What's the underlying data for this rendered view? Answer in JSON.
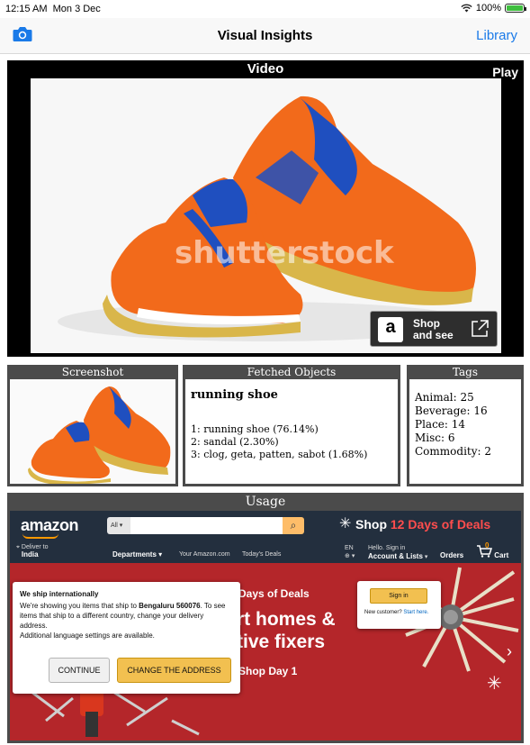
{
  "status_bar": {
    "time": "12:15 AM",
    "date": "Mon 3 Dec",
    "battery": "100%",
    "wifi_icon": "wifi-icon"
  },
  "navbar": {
    "title": "Visual Insights",
    "library_label": "Library",
    "camera_icon": "camera-icon"
  },
  "video": {
    "header": "Video",
    "play_label": "Play",
    "watermark": "shutterstock",
    "shop_button": {
      "line1": "Shop",
      "line2": "and see",
      "logo_letter": "a"
    }
  },
  "screenshot_panel": {
    "header": "Screenshot"
  },
  "fetched_panel": {
    "header": "Fetched Objects",
    "top_result": "running shoe",
    "results": [
      "1: running shoe (76.14%)",
      "2: sandal (2.30%)",
      "3: clog, geta, patten, sabot (1.68%)"
    ]
  },
  "tags_panel": {
    "header": "Tags",
    "tags": [
      "Animal: 25",
      "Beverage: 16",
      "Place: 14",
      "Misc: 6",
      "Commodity: 2"
    ]
  },
  "usage_panel": {
    "header": "Usage",
    "amazon": {
      "logo": "amazon",
      "search_category": "All",
      "promo_prefix": "Shop",
      "promo_highlight": "12 Days of Deals",
      "deliver_to": "Deliver to",
      "deliver_country": "India",
      "departments": "Departments",
      "your_amazon": "Your Amazon.com",
      "todays_deals": "Today's Deals",
      "lang": "EN",
      "hello": "Hello. Sign in",
      "account": "Account & Lists",
      "orders": "Orders",
      "cart": "Cart",
      "cart_count": "0",
      "banner_line1": "Days of Deals",
      "banner_line2": "rt homes &",
      "banner_line3": "tive fixers",
      "banner_line4": "Shop Day 1",
      "popup": {
        "title": "We ship internationally",
        "text_before": "We're showing you items that ship to ",
        "text_bold": "Bengaluru 560076",
        "text_after": ". To see items that ship to a different country, change your delivery address.",
        "text2": "Additional language settings are available.",
        "continue_label": "CONTINUE",
        "change_label": "CHANGE THE ADDRESS"
      },
      "signin": {
        "button": "Sign in",
        "new_customer": "New customer?",
        "start_here": "Start here."
      }
    }
  },
  "colors": {
    "accent": "#1a7ae8",
    "panel": "#4b4b4b",
    "amazon_dark": "#232f3e",
    "amazon_orange": "#ff9900",
    "banner_red": "#b4262a"
  }
}
